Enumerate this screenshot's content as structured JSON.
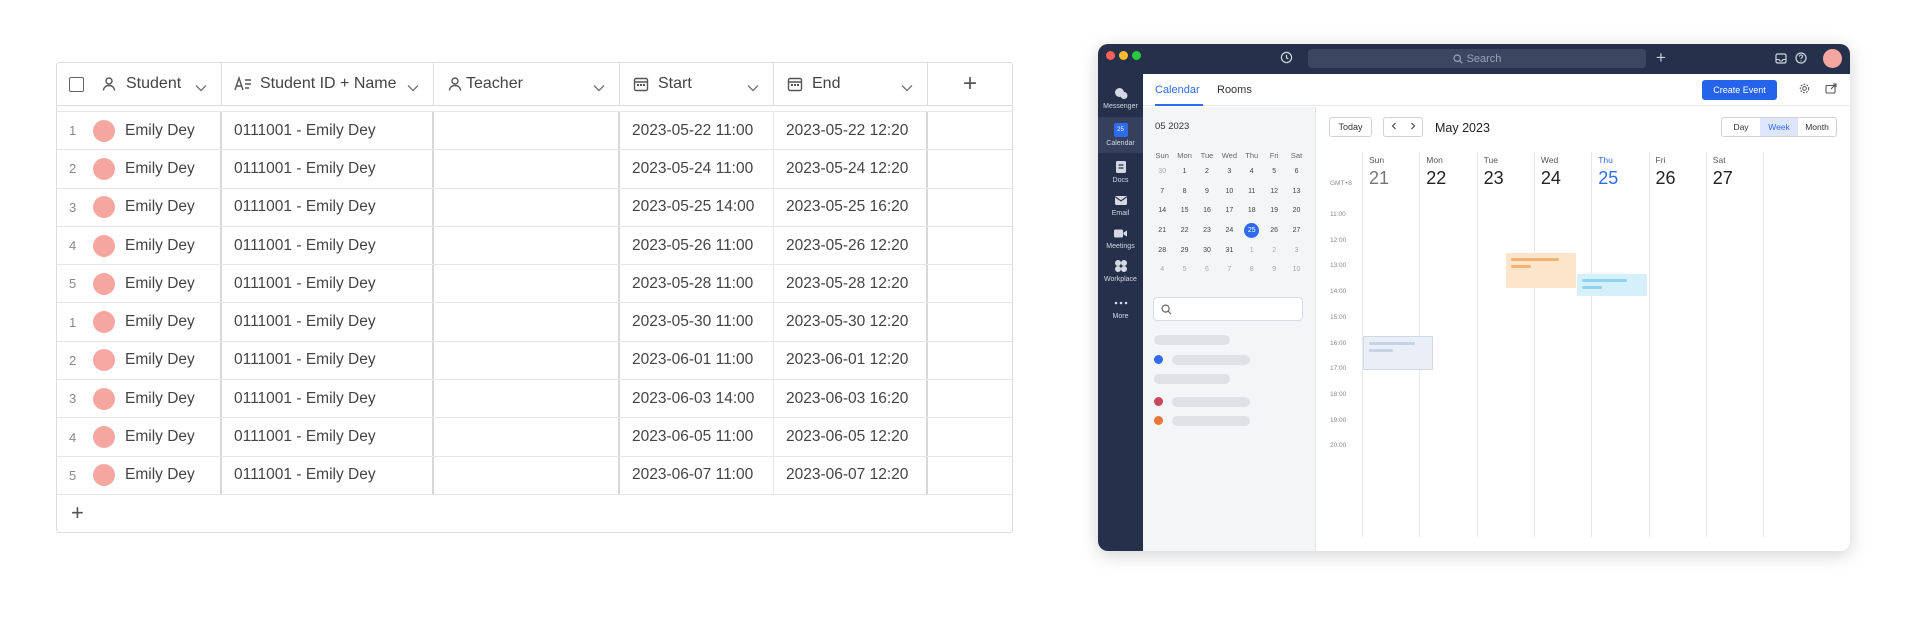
{
  "table": {
    "columns": [
      {
        "label": "Student",
        "icon": "person-icon"
      },
      {
        "label": "Student ID + Name",
        "icon": "formula-text-icon"
      },
      {
        "label": "Teacher",
        "icon": "person-icon"
      },
      {
        "label": "Start",
        "icon": "calendar-icon"
      },
      {
        "label": "End",
        "icon": "calendar-icon"
      }
    ],
    "add_column_label": "+",
    "add_row_label": "+",
    "rows": [
      {
        "num": "1",
        "student": "Emily Dey",
        "id_name": "0111001 - Emily Dey",
        "teacher": "",
        "start": "2023-05-22 11:00",
        "end": "2023-05-22 12:20"
      },
      {
        "num": "2",
        "student": "Emily Dey",
        "id_name": "0111001 - Emily Dey",
        "teacher": "",
        "start": "2023-05-24 11:00",
        "end": "2023-05-24 12:20"
      },
      {
        "num": "3",
        "student": "Emily Dey",
        "id_name": "0111001 - Emily Dey",
        "teacher": "",
        "start": "2023-05-25 14:00",
        "end": "2023-05-25 16:20"
      },
      {
        "num": "4",
        "student": "Emily Dey",
        "id_name": "0111001 - Emily Dey",
        "teacher": "",
        "start": "2023-05-26 11:00",
        "end": "2023-05-26 12:20"
      },
      {
        "num": "5",
        "student": "Emily Dey",
        "id_name": "0111001 - Emily Dey",
        "teacher": "",
        "start": "2023-05-28 11:00",
        "end": "2023-05-28 12:20"
      },
      {
        "num": "1",
        "student": "Emily Dey",
        "id_name": "0111001 - Emily Dey",
        "teacher": "",
        "start": "2023-05-30 11:00",
        "end": "2023-05-30 12:20"
      },
      {
        "num": "2",
        "student": "Emily Dey",
        "id_name": "0111001 - Emily Dey",
        "teacher": "",
        "start": "2023-06-01 11:00",
        "end": "2023-06-01 12:20"
      },
      {
        "num": "3",
        "student": "Emily Dey",
        "id_name": "0111001 - Emily Dey",
        "teacher": "",
        "start": "2023-06-03 14:00",
        "end": "2023-06-03 16:20"
      },
      {
        "num": "4",
        "student": "Emily Dey",
        "id_name": "0111001 - Emily Dey",
        "teacher": "",
        "start": "2023-06-05 11:00",
        "end": "2023-06-05 12:20"
      },
      {
        "num": "5",
        "student": "Emily Dey",
        "id_name": "0111001 - Emily Dey",
        "teacher": "",
        "start": "2023-06-07 11:00",
        "end": "2023-06-07 12:20"
      }
    ]
  },
  "app": {
    "search_placeholder": "Search",
    "nav": [
      {
        "label": "Messenger",
        "icon": "messenger-icon"
      },
      {
        "label": "Calendar",
        "icon": "calendar-icon",
        "badge": "25"
      },
      {
        "label": "Docs",
        "icon": "docs-icon"
      },
      {
        "label": "Email",
        "icon": "email-icon"
      },
      {
        "label": "Meetings",
        "icon": "video-icon"
      },
      {
        "label": "Workplace",
        "icon": "workplace-icon"
      },
      {
        "label": "More",
        "icon": "more-icon"
      }
    ],
    "tabs": [
      "Calendar",
      "Rooms"
    ],
    "create_label": "Create Event",
    "mini_title": "05 2023",
    "weekdays": [
      "Sun",
      "Mon",
      "Tue",
      "Wed",
      "Thu",
      "Fri",
      "Sat"
    ],
    "mini_days": [
      [
        "30",
        "1",
        "2",
        "3",
        "4",
        "5",
        "6"
      ],
      [
        "7",
        "8",
        "9",
        "10",
        "11",
        "12",
        "13"
      ],
      [
        "14",
        "15",
        "16",
        "17",
        "18",
        "19",
        "20"
      ],
      [
        "21",
        "22",
        "23",
        "24",
        "25",
        "26",
        "27"
      ],
      [
        "28",
        "29",
        "30",
        "31",
        "1",
        "2",
        "3"
      ],
      [
        "4",
        "5",
        "6",
        "7",
        "8",
        "9",
        "10"
      ]
    ],
    "today_btn": "Today",
    "month_title": "May 2023",
    "views": [
      "Day",
      "Week",
      "Month"
    ],
    "active_view": "Week",
    "timezone": "GMT+8",
    "week_days": [
      {
        "name": "Sun",
        "date": "21"
      },
      {
        "name": "Mon",
        "date": "22"
      },
      {
        "name": "Tue",
        "date": "23"
      },
      {
        "name": "Wed",
        "date": "24"
      },
      {
        "name": "Thu",
        "date": "25"
      },
      {
        "name": "Fri",
        "date": "26"
      },
      {
        "name": "Sat",
        "date": "27"
      }
    ],
    "times": [
      "11:00",
      "12:00",
      "13:00",
      "14:00",
      "15:00",
      "16:00",
      "17:00",
      "18:00",
      "19:00",
      "20:00"
    ],
    "colors": {
      "accent": "#2563eb",
      "sidebar": "#25304a",
      "avatar": "#f6a6a0",
      "event_orange": "#fde5cc",
      "event_blue": "#d5f0fb",
      "event_gray": "#e9eef7"
    }
  }
}
